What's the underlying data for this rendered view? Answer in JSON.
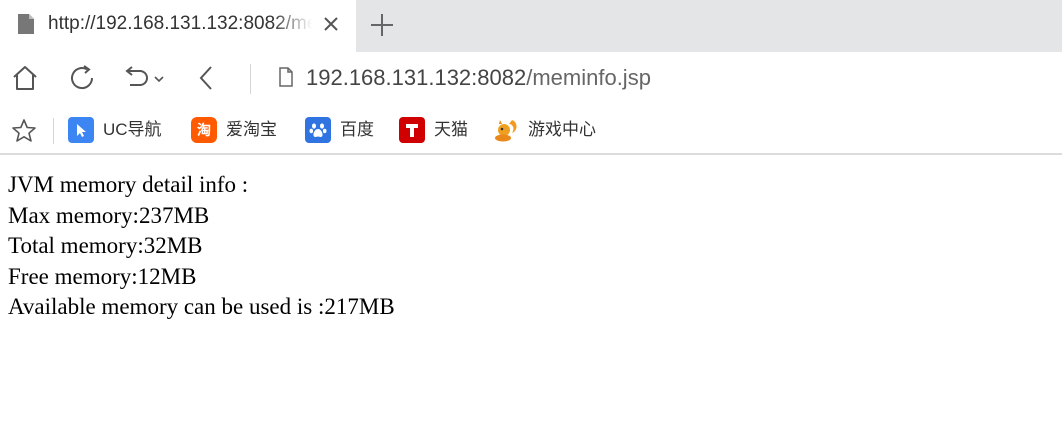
{
  "tab": {
    "title": "http://192.168.131.132:8082/meminfo.jsp",
    "page_icon": "document-icon",
    "close_icon": "close-icon",
    "new_tab_icon": "plus-icon"
  },
  "navbar": {
    "home_icon": "home-icon",
    "reload_icon": "reload-icon",
    "undo_icon": "undo-dropdown-icon",
    "back_icon": "back-icon",
    "address_host": "192.168.131.132:8082",
    "address_path": "/meminfo.jsp"
  },
  "bookmarks": {
    "star_icon": "star-icon",
    "items": [
      {
        "label": "UC导航",
        "icon": "uc-nav-icon",
        "color": "#3b86f2"
      },
      {
        "label": "爱淘宝",
        "icon": "taobao-icon",
        "color": "#ff5a00"
      },
      {
        "label": "百度",
        "icon": "baidu-paw-icon",
        "color": "#2f74e0"
      },
      {
        "label": "天猫",
        "icon": "tmall-icon",
        "color": "#d10000"
      },
      {
        "label": "游戏中心",
        "icon": "squirrel-icon",
        "color": "#f0a020"
      }
    ]
  },
  "page": {
    "lines": [
      "JVM memory detail info :",
      "Max memory:237MB",
      "Total memory:32MB",
      "Free memory:12MB",
      "Available memory can be used is :217MB"
    ]
  }
}
